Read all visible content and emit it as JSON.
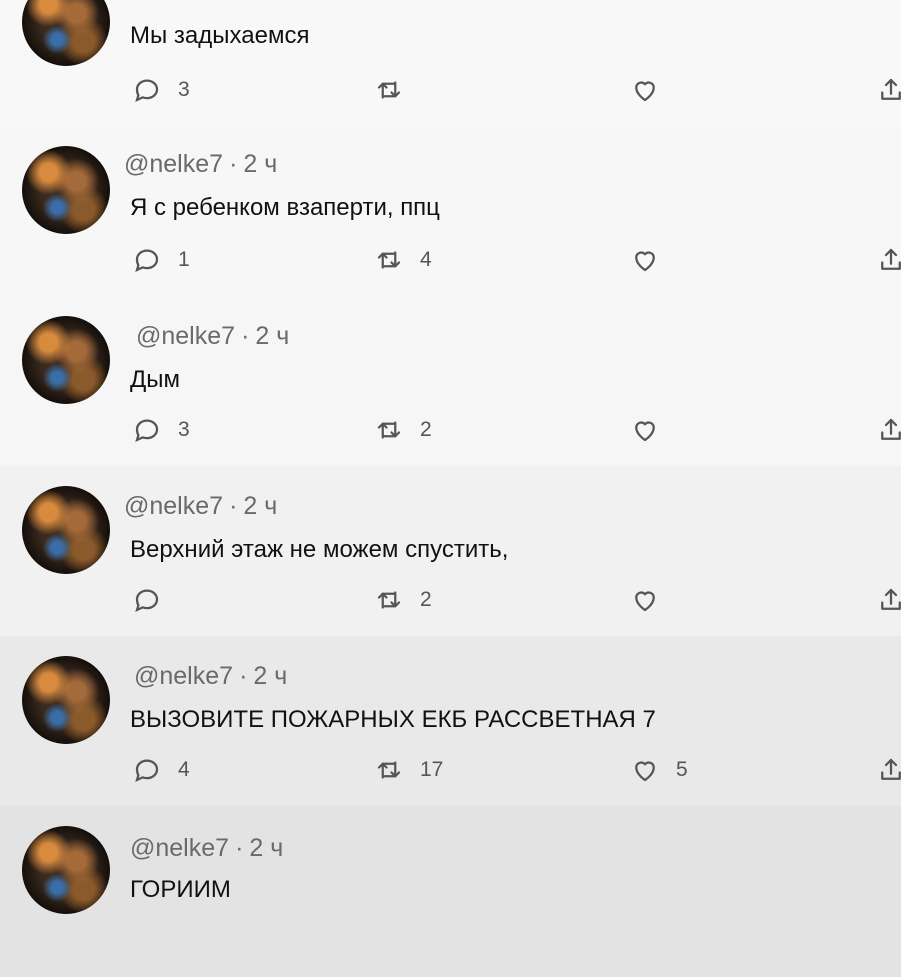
{
  "posts": [
    {
      "handle": "",
      "sep": "",
      "time": "",
      "text": "Мы задыхаемся",
      "replies": "3",
      "retweets": "",
      "likes": ""
    },
    {
      "handle": "@nelke7",
      "sep": "·",
      "time": "2 ч",
      "text": "Я с ребенком взаперти, ппц",
      "replies": "1",
      "retweets": "4",
      "likes": ""
    },
    {
      "handle": "@nelke7",
      "sep": "·",
      "time": "2 ч",
      "text": "Дым",
      "replies": "3",
      "retweets": "2",
      "likes": ""
    },
    {
      "handle": "@nelke7",
      "sep": "·",
      "time": "2 ч",
      "text": "Верхний этаж не можем спустить,",
      "replies": "",
      "retweets": "2",
      "likes": ""
    },
    {
      "handle": "@nelke7",
      "sep": "·",
      "time": "2 ч",
      "text": "ВЫЗОВИТЕ ПОЖАРНЫХ ЕКБ РАССВЕТНАЯ 7",
      "replies": "4",
      "retweets": "17",
      "likes": "5"
    },
    {
      "handle": "@nelke7",
      "sep": "·",
      "time": "2 ч",
      "text": "ГОРИИМ",
      "replies": "",
      "retweets": "",
      "likes": ""
    }
  ],
  "icons": {
    "reply": "reply-icon",
    "retweet": "retweet-icon",
    "like": "heart-icon",
    "share": "share-icon"
  },
  "colors": {
    "icon": "#555555",
    "meta": "#6a6a6a"
  }
}
